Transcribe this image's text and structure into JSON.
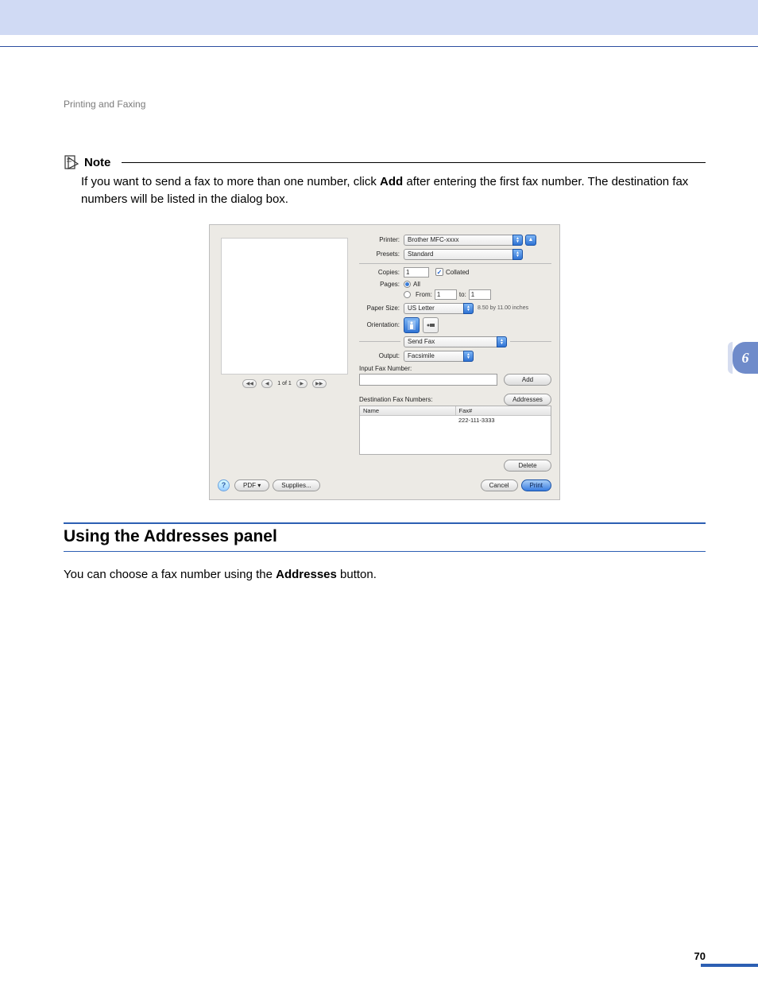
{
  "headerSection": "Printing and Faxing",
  "note": {
    "label": "Note",
    "body_pre": "If you want to send a fax to more than one number, click ",
    "body_bold": "Add",
    "body_post": " after entering the first fax number. The destination fax numbers will be listed in the dialog box."
  },
  "dialog": {
    "printerLabel": "Printer:",
    "printerValue": "Brother MFC-xxxx",
    "presetsLabel": "Presets:",
    "presetsValue": "Standard",
    "copiesLabel": "Copies:",
    "copiesValue": "1",
    "collatedLabel": "Collated",
    "pagesLabel": "Pages:",
    "pagesAll": "All",
    "pagesFrom": "From:",
    "pagesFromVal": "1",
    "pagesTo": "to:",
    "pagesToVal": "1",
    "paperSizeLabel": "Paper Size:",
    "paperSizeValue": "US Letter",
    "paperSizeDims": "8.50 by 11.00 inches",
    "orientationLabel": "Orientation:",
    "panelSelect": "Send Fax",
    "outputLabel": "Output:",
    "outputValue": "Facsimile",
    "inputFaxLabel": "Input Fax Number:",
    "addBtn": "Add",
    "destLabel": "Destination Fax Numbers:",
    "addressesBtn": "Addresses",
    "colName": "Name",
    "colFax": "Fax#",
    "rowFax": "222-111-3333",
    "deleteBtn": "Delete",
    "pdfBtn": "PDF ▾",
    "suppliesBtn": "Supplies...",
    "cancelBtn": "Cancel",
    "printBtn": "Print",
    "previewCounter": "1 of 1"
  },
  "section2": {
    "heading": "Using the Addresses panel",
    "body_pre": "You can choose a fax number using the ",
    "body_bold": "Addresses",
    "body_post": " button."
  },
  "chapterNumber": "6",
  "pageNumber": "70"
}
